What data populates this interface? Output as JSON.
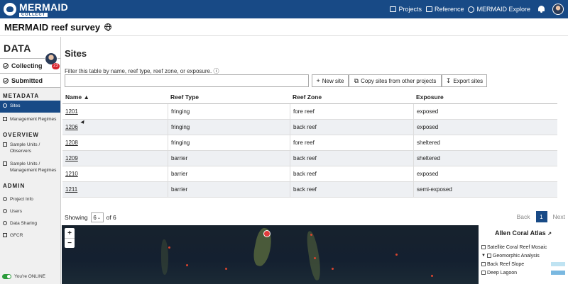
{
  "app": {
    "logo_name": "MERMAID",
    "logo_sub": "COLLECT"
  },
  "nav": {
    "projects": "Projects",
    "reference": "Reference",
    "explore": "MERMAID Explore"
  },
  "project": {
    "title": "MERMAID reef survey"
  },
  "sidebar": {
    "data_label": "DATA",
    "badge_count": "23",
    "collecting": "Collecting",
    "submitted": "Submitted",
    "metadata_label": "METADATA",
    "metadata_items": [
      "Sites",
      "Management Regimes"
    ],
    "overview_label": "OVERVIEW",
    "overview_items": [
      "Sample Units / Observers",
      "Sample Units / Management Regimes"
    ],
    "admin_label": "ADMIN",
    "admin_items": [
      "Project Info",
      "Users",
      "Data Sharing",
      "GFCR"
    ],
    "online": "You're ONLINE"
  },
  "main": {
    "title": "Sites",
    "filter_label": "Filter this table by name, reef type, reef zone, or exposure.",
    "filter_value": "",
    "new_site": "New site",
    "copy_sites": "Copy sites from other projects",
    "export_sites": "Export sites"
  },
  "table": {
    "headers": [
      "Name ▲",
      "Reef Type",
      "Reef Zone",
      "Exposure"
    ],
    "rows": [
      [
        "1201",
        "fringing",
        "fore reef",
        "exposed"
      ],
      [
        "1206",
        "fringing",
        "back reef",
        "exposed"
      ],
      [
        "1208",
        "fringing",
        "fore reef",
        "sheltered"
      ],
      [
        "1209",
        "barrier",
        "back reef",
        "sheltered"
      ],
      [
        "1210",
        "barrier",
        "back reef",
        "exposed"
      ],
      [
        "1211",
        "barrier",
        "back reef",
        "semi-exposed"
      ]
    ]
  },
  "pager": {
    "showing": "Showing",
    "page_size": "6",
    "of_label": "of 6",
    "back": "Back",
    "page": "1",
    "next": "Next"
  },
  "map": {
    "zoom_in": "+",
    "zoom_out": "−",
    "atlas_title": "Allen Coral Atlas",
    "atlas_items": [
      "Satellite Coral Reef Mosaic",
      "Geomorphic Analysis",
      "Back Reef Slope",
      "Deep Lagoon"
    ]
  },
  "colors": {
    "brand": "#184a86",
    "badge": "#d9232e",
    "online": "#2c9c3c"
  }
}
